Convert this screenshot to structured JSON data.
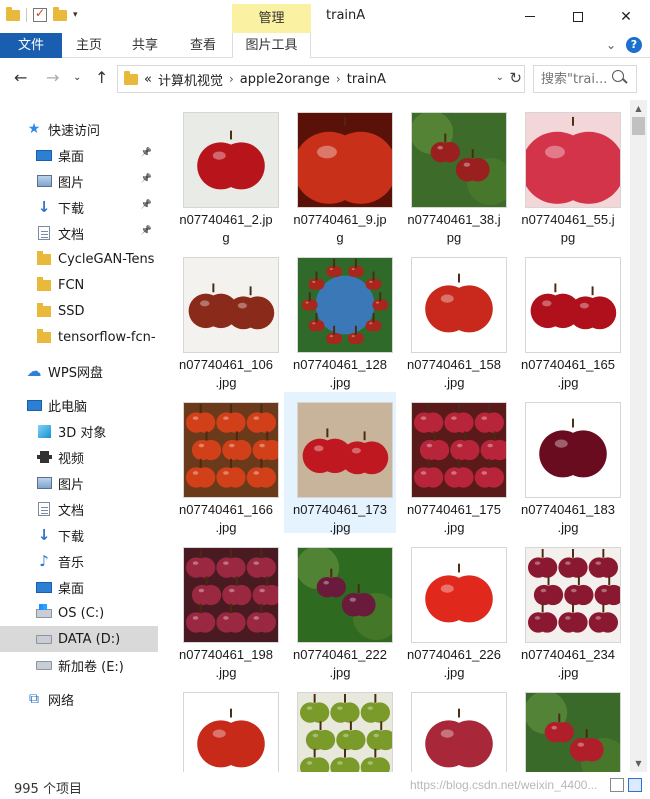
{
  "window": {
    "title": "trainA",
    "context_tab_group": "管理"
  },
  "ribbon": {
    "file_tab": "文件",
    "tabs": [
      "主页",
      "共享",
      "查看"
    ],
    "tool_tab": "图片工具"
  },
  "address": {
    "overflow": "«",
    "path": [
      "计算机视觉",
      "apple2orange",
      "trainA"
    ],
    "search_placeholder": "搜索\"trai..."
  },
  "nav": {
    "items": [
      {
        "label": "快速访问",
        "icon": "star-icon",
        "indent": 1,
        "pinned": false
      },
      {
        "label": "桌面",
        "icon": "desktop-icon",
        "indent": 2,
        "pinned": true
      },
      {
        "label": "图片",
        "icon": "pictures-icon",
        "indent": 2,
        "pinned": true
      },
      {
        "label": "下载",
        "icon": "download-icon",
        "indent": 2,
        "pinned": true
      },
      {
        "label": "文档",
        "icon": "documents-icon",
        "indent": 2,
        "pinned": true
      },
      {
        "label": "CycleGAN-Tens",
        "icon": "folder-icon",
        "indent": 2,
        "pinned": false
      },
      {
        "label": "FCN",
        "icon": "folder-icon",
        "indent": 2,
        "pinned": false
      },
      {
        "label": "SSD",
        "icon": "folder-icon",
        "indent": 2,
        "pinned": false
      },
      {
        "label": "tensorflow-fcn-",
        "icon": "folder-icon",
        "indent": 2,
        "pinned": false
      },
      {
        "label": "WPS网盘",
        "icon": "cloud-icon",
        "indent": 1,
        "pinned": false,
        "gap": true
      },
      {
        "label": "此电脑",
        "icon": "computer-icon",
        "indent": 1,
        "pinned": false,
        "gap": true
      },
      {
        "label": "3D 对象",
        "icon": "3d-objects-icon",
        "indent": 2,
        "pinned": false
      },
      {
        "label": "视频",
        "icon": "video-icon",
        "indent": 2,
        "pinned": false
      },
      {
        "label": "图片",
        "icon": "pictures-icon",
        "indent": 2,
        "pinned": false
      },
      {
        "label": "文档",
        "icon": "documents-icon",
        "indent": 2,
        "pinned": false
      },
      {
        "label": "下载",
        "icon": "download-icon",
        "indent": 2,
        "pinned": false
      },
      {
        "label": "音乐",
        "icon": "music-icon",
        "indent": 2,
        "pinned": false
      },
      {
        "label": "桌面",
        "icon": "desktop-icon",
        "indent": 2,
        "pinned": false
      },
      {
        "label": "OS (C:)",
        "icon": "os-drive-icon",
        "indent": 2,
        "pinned": false
      },
      {
        "label": "DATA (D:)",
        "icon": "drive-icon",
        "indent": 2,
        "pinned": false,
        "selected": true
      },
      {
        "label": "新加卷 (E:)",
        "icon": "drive-icon",
        "indent": 2,
        "pinned": false
      },
      {
        "label": "网络",
        "icon": "network-icon",
        "indent": 1,
        "pinned": false,
        "gap": true
      }
    ]
  },
  "files": [
    {
      "name": "n07740461_2.jpg",
      "line1": "n07740461_2.jp",
      "line2": "g",
      "bg": "#e9ebe7",
      "apple": "#b8141c",
      "scene": "knit"
    },
    {
      "name": "n07740461_9.jpg",
      "line1": "n07740461_9.jp",
      "line2": "g",
      "bg": "#5a1208",
      "apple": "#c9301a",
      "scene": "close"
    },
    {
      "name": "n07740461_38.jpg",
      "line1": "n07740461_38.j",
      "line2": "pg",
      "bg": "#3c6b2a",
      "apple": "#9a1f1f",
      "scene": "tree"
    },
    {
      "name": "n07740461_55.jpg",
      "line1": "n07740461_55.j",
      "line2": "pg",
      "bg": "#f2d6d8",
      "apple": "#d4344a",
      "scene": "close"
    },
    {
      "name": "n07740461_106.jpg",
      "line1": "n07740461_106",
      "line2": ".jpg",
      "bg": "#f4f2ee",
      "apple": "#8a2a1a",
      "scene": "two"
    },
    {
      "name": "n07740461_128.jpg",
      "line1": "n07740461_128",
      "line2": ".jpg",
      "bg": "#2f6a2a",
      "apple": "#a8261c",
      "scene": "arch"
    },
    {
      "name": "n07740461_158.jpg",
      "line1": "n07740461_158",
      "line2": ".jpg",
      "bg": "#ffffff",
      "apple": "#c9281c",
      "scene": "single"
    },
    {
      "name": "n07740461_165.jpg",
      "line1": "n07740461_165",
      "line2": ".jpg",
      "bg": "#ffffff",
      "apple": "#b0101c",
      "scene": "two"
    },
    {
      "name": "n07740461_166.jpg",
      "line1": "n07740461_166",
      "line2": ".jpg",
      "bg": "#6b3a1a",
      "apple": "#d2401a",
      "scene": "pile"
    },
    {
      "name": "n07740461_173.jpg",
      "line1": "n07740461_173",
      "line2": ".jpg",
      "bg": "#c8b49a",
      "apple": "#c01820",
      "scene": "two",
      "selected": true
    },
    {
      "name": "n07740461_175.jpg",
      "line1": "n07740461_175",
      "line2": ".jpg",
      "bg": "#5a1a1a",
      "apple": "#b8243a",
      "scene": "pile"
    },
    {
      "name": "n07740461_183.jpg",
      "line1": "n07740461_183",
      "line2": ".jpg",
      "bg": "#ffffff",
      "apple": "#6a0c20",
      "scene": "single"
    },
    {
      "name": "n07740461_198.jpg",
      "line1": "n07740461_198",
      "line2": ".jpg",
      "bg": "#4a1a22",
      "apple": "#9a2840",
      "scene": "pile"
    },
    {
      "name": "n07740461_222.jpg",
      "line1": "n07740461_222",
      "line2": ".jpg",
      "bg": "#2e6a20",
      "apple": "#6a1a3a",
      "scene": "tree"
    },
    {
      "name": "n07740461_226.jpg",
      "line1": "n07740461_226",
      "line2": ".jpg",
      "bg": "#ffffff",
      "apple": "#e0281c",
      "scene": "single"
    },
    {
      "name": "n07740461_234.jpg",
      "line1": "n07740461_234",
      "line2": ".jpg",
      "bg": "#f4f0ee",
      "apple": "#8a1830",
      "scene": "pile"
    },
    {
      "name": "",
      "line1": "",
      "line2": "",
      "bg": "#ffffff",
      "apple": "#c82a1a",
      "scene": "single"
    },
    {
      "name": "",
      "line1": "",
      "line2": "",
      "bg": "#e8e8dc",
      "apple": "#7a9a2a",
      "scene": "pile"
    },
    {
      "name": "",
      "line1": "",
      "line2": "",
      "bg": "#ffffff",
      "apple": "#a8283a",
      "scene": "single"
    },
    {
      "name": "",
      "line1": "",
      "line2": "",
      "bg": "#3a6a2a",
      "apple": "#b01e2a",
      "scene": "tree"
    }
  ],
  "status": {
    "count": "995 个项目",
    "watermark": "https://blog.csdn.net/weixin_4400..."
  },
  "colors": {
    "accent": "#1a5eb0",
    "context_tab": "#fbf1a3",
    "selection": "#e5f3ff",
    "nav_selected": "#d9d9d9"
  }
}
